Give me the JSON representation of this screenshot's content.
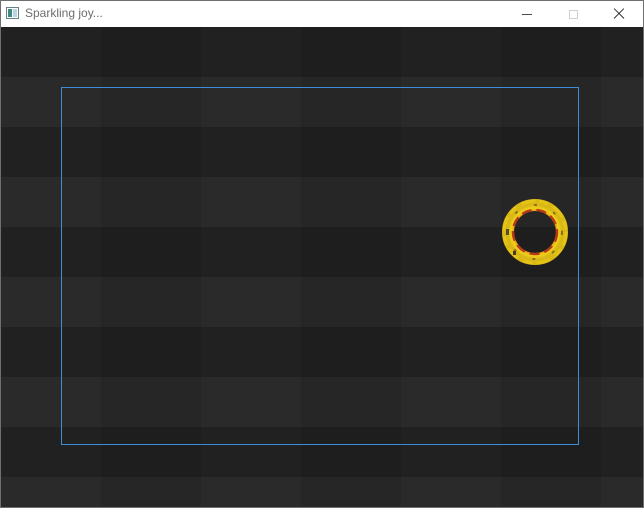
{
  "window": {
    "title": "Sparkling joy...",
    "app_icon": "app-window-icon",
    "buttons": {
      "minimize_icon": "minimize-icon",
      "maximize_icon": "maximize-icon",
      "close_icon": "close-icon"
    }
  },
  "canvas": {
    "background": "#262626",
    "bounds_color": "#3a8fd8",
    "sprite": {
      "name": "sparkling-ring",
      "colors": [
        "#f2d21a",
        "#e27a10",
        "#c13a16",
        "#7a5a2a"
      ]
    }
  }
}
